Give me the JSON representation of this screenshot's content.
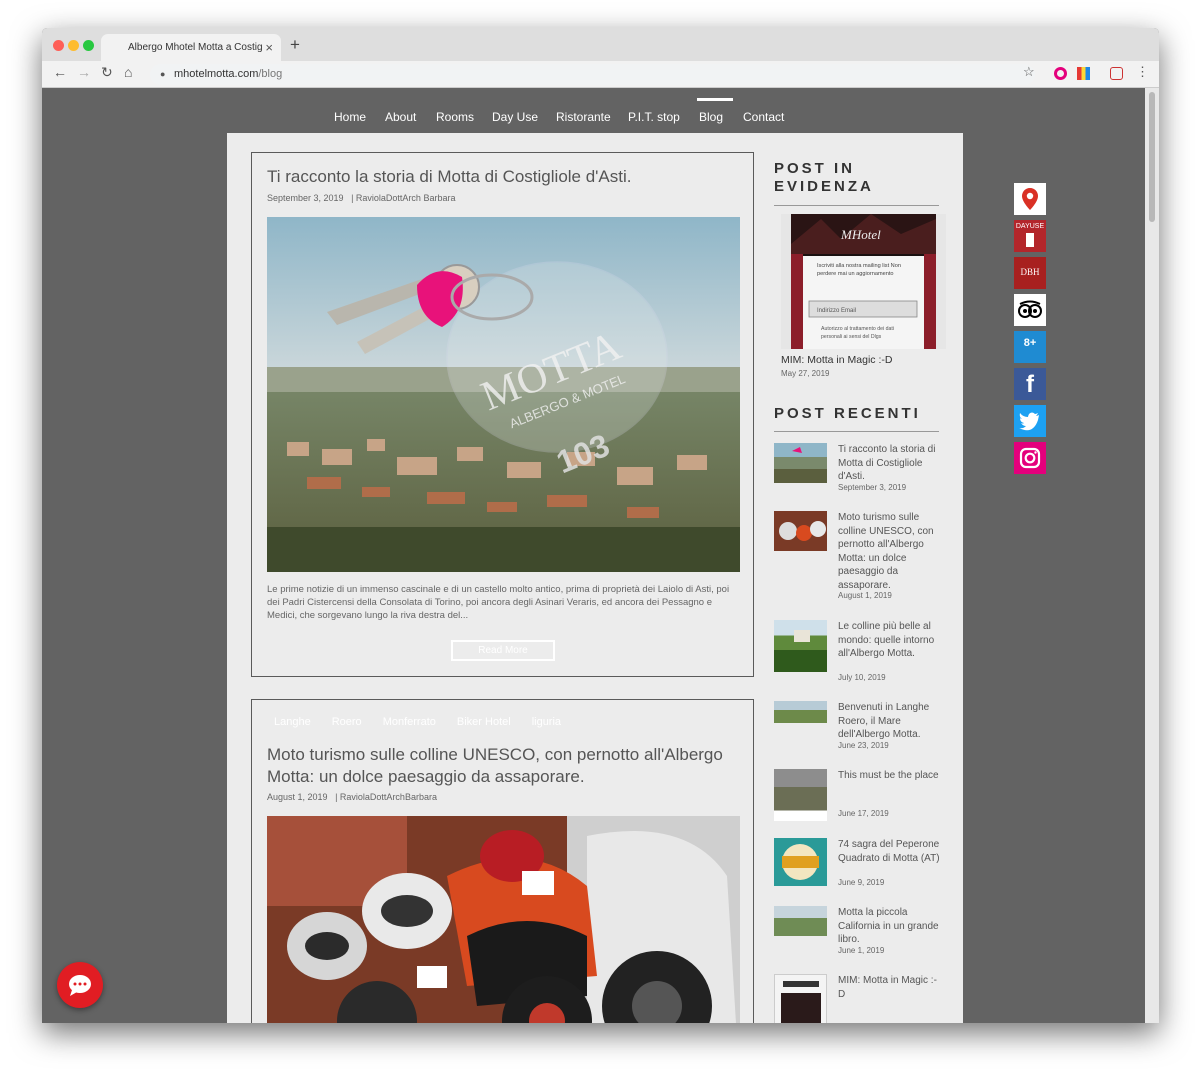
{
  "browser": {
    "tab_title": "Albergo Mhotel Motta a Costig",
    "close_glyph": "×",
    "new_tab_glyph": "+",
    "url_host": "mhotelmotta.com",
    "url_path": "/blog",
    "back_glyph": "←",
    "forward_glyph": "→",
    "reload_glyph": "↻",
    "home_glyph": "⌂",
    "star_glyph": "☆",
    "menu_glyph": "⋮"
  },
  "nav": {
    "items": [
      "Home",
      "About",
      "Rooms",
      "Day Use",
      "Ristorante",
      "P.I.T. stop",
      "Blog",
      "Contact"
    ],
    "active": "Blog"
  },
  "posts": [
    {
      "title": "Ti racconto la storia di Motta di Costigliole d'Asti.",
      "date": "September 3, 2019",
      "author": "|  RaviolaDottArch Barbara",
      "excerpt": "Le prime notizie di un immenso cascinale e di un castello molto antico, prima di proprietà dei Laiolo di Asti, poi dei Padri Cistercensi della Consolata di Torino, poi ancora degli Asinari Veraris, ed ancora dei Pessagno e Medici, che sorgevano lungo la riva destra del...",
      "read_more": "Read More",
      "keytag_brand": "MOTTA",
      "keytag_sub": "ALBERGO & MOTEL",
      "keytag_number": "103"
    },
    {
      "tags": [
        "Langhe",
        "Roero",
        "Monferrato",
        "Biker Hotel",
        "liguria"
      ],
      "title": "Moto turismo sulle colline UNESCO, con pernotto all'Albergo Motta: un dolce paesaggio da assaporare.",
      "date": "August 1, 2019",
      "author": "|  RaviolaDottArchBarbara"
    }
  ],
  "sidebar": {
    "featured_heading": "POST IN EVIDENZA",
    "featured": {
      "title": "MIM: Motta in Magic :-D",
      "date": "May 27, 2019",
      "logo_text": "MHotel",
      "popup_text": "Iscriviti alla nostra mailing list Non perdere mai un aggiornamento",
      "email_placeholder": "Indirizzo Email",
      "consent_text": "Autorizzo al trattamento dei dati personali ai sensi del Dlgs"
    },
    "recent_heading": "POST RECENTI",
    "recent": [
      {
        "title": "Ti racconto la storia di Motta di Costigliole d'Asti.",
        "date": "September 3, 2019"
      },
      {
        "title": "Moto turismo sulle colline UNESCO, con pernotto all'Albergo Motta: un dolce paesaggio da assaporare.",
        "date": "August 1, 2019"
      },
      {
        "title": "Le colline più belle al mondo: quelle intorno all'Albergo Motta.",
        "date": "July 10, 2019"
      },
      {
        "title": "Benvenuti in Langhe Roero, il Mare dell'Albergo Motta.",
        "date": "June 23, 2019"
      },
      {
        "title": "This must be the place",
        "date": "June 17, 2019"
      },
      {
        "title": "74 sagra del Peperone Quadrato di Motta (AT)",
        "date": "June 9, 2019"
      },
      {
        "title": "Motta la piccola California in un grande libro.",
        "date": "June 1, 2019"
      },
      {
        "title": "MIM: Motta in Magic :-D",
        "date": ""
      }
    ]
  },
  "social": [
    {
      "name": "google-maps",
      "color": "#ffffff"
    },
    {
      "name": "dayuse",
      "color": "#b3262b",
      "label": "DAYUSE"
    },
    {
      "name": "dbh",
      "color": "#a8201f",
      "label": "DBH"
    },
    {
      "name": "tripadvisor",
      "color": "#ffffff"
    },
    {
      "name": "booking",
      "color": "#1f8bd2",
      "label": "8+"
    },
    {
      "name": "facebook",
      "color": "#3b5998",
      "label": "f"
    },
    {
      "name": "twitter",
      "color": "#1da1f2"
    },
    {
      "name": "instagram",
      "color": "#e4007c"
    }
  ],
  "chat": {
    "glyph": "●●●"
  }
}
